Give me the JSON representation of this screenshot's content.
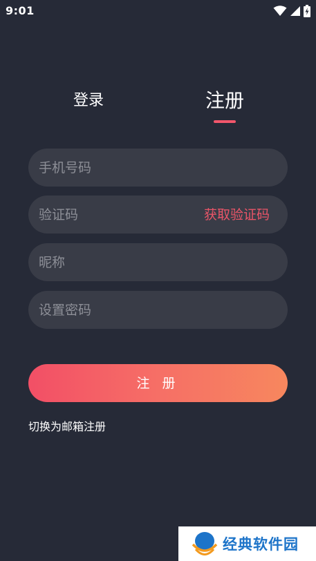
{
  "status_bar": {
    "time": "9:01"
  },
  "tabs": {
    "login_label": "登录",
    "register_label": "注册",
    "active": "register"
  },
  "form": {
    "phone_placeholder": "手机号码",
    "code_placeholder": "验证码",
    "get_code_label": "获取验证码",
    "nickname_placeholder": "昵称",
    "password_placeholder": "设置密码",
    "submit_label": "注 册",
    "switch_label": "切换为邮箱注册"
  },
  "watermark": {
    "text": "经典软件园"
  },
  "colors": {
    "background": "#262a37",
    "field_background": "#393c47",
    "accent": "#ea5568",
    "gradient_start": "#f24f66",
    "gradient_end": "#f7875e",
    "watermark_text": "#1d74c9"
  },
  "icons": {
    "wifi": "wifi-icon",
    "signal": "signal-icon",
    "battery": "battery-charging-icon"
  }
}
